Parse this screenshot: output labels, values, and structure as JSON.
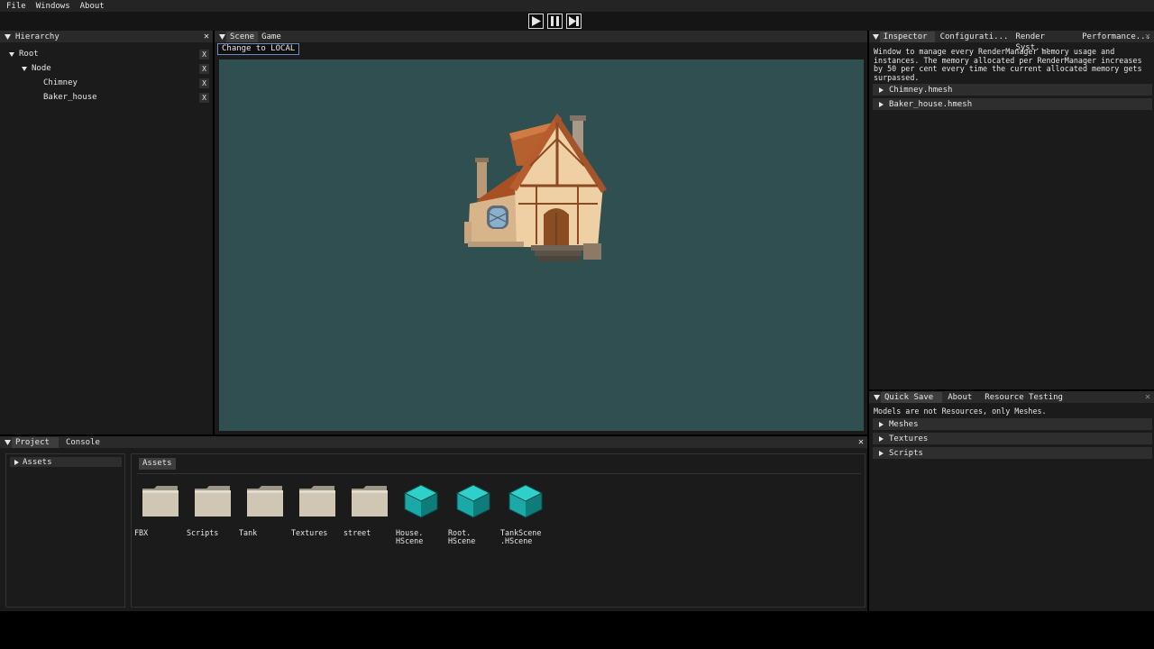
{
  "menu": [
    "File",
    "Windows",
    "About"
  ],
  "hierarchy": {
    "title": "Hierarchy",
    "nodes": [
      {
        "label": "Root"
      },
      {
        "label": "Node"
      },
      {
        "label": "Chimney"
      },
      {
        "label": "Baker_house"
      }
    ],
    "remove_label": "X"
  },
  "scene": {
    "tabs": [
      "Scene",
      "Game"
    ],
    "mode_button": "Change to LOCAL"
  },
  "inspector": {
    "tabs": [
      "Inspector",
      "Configurati...",
      "Render Syst...",
      "Performance..."
    ],
    "description": "Window to manage every RenderManager memory usage and instances. The memory allocated per RenderManager increases by 50 per cent every time the current allocated memory gets surpassed.",
    "items": [
      "Chimney.hmesh",
      "Baker_house.hmesh"
    ]
  },
  "lower_right": {
    "tabs": [
      "Quick Save",
      "About",
      "Resource Testing"
    ],
    "note": "Models are not Resources, only Meshes.",
    "sections": [
      "Meshes",
      "Textures",
      "Scripts"
    ]
  },
  "project": {
    "tabs": [
      "Project",
      "Console"
    ],
    "tree_root": "Assets",
    "breadcrumb": "Assets",
    "items": [
      {
        "label": "FBX",
        "icon": "folder-icon"
      },
      {
        "label": "Scripts",
        "icon": "folder-icon"
      },
      {
        "label": "Tank",
        "icon": "folder-icon"
      },
      {
        "label": "Textures",
        "icon": "folder-icon"
      },
      {
        "label": "street",
        "icon": "folder-icon"
      },
      {
        "label": "House.\nHScene",
        "icon": "scene-cube-icon"
      },
      {
        "label": "Root.\nHScene",
        "icon": "scene-cube-icon"
      },
      {
        "label": "TankScene\n.HScene",
        "icon": "scene-cube-icon"
      }
    ]
  },
  "colors": {
    "scene_background": "#2f4f51",
    "panel_background": "#1b1b1b",
    "active_tab": "#3d3d3d",
    "scene_cube": "#1aa9a6",
    "folder": "#cfc7b4"
  }
}
